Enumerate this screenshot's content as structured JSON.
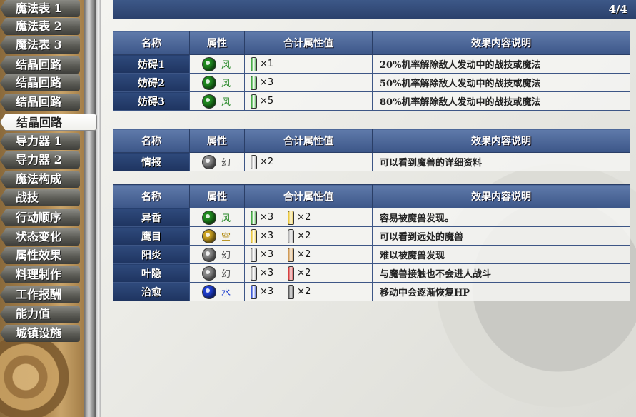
{
  "sidebar": {
    "items": [
      {
        "label": "魔法表 1",
        "active": false
      },
      {
        "label": "魔法表 2",
        "active": false
      },
      {
        "label": "魔法表 3",
        "active": false
      },
      {
        "label": "结晶回路",
        "active": false
      },
      {
        "label": "结晶回路",
        "active": false
      },
      {
        "label": "结晶回路",
        "active": false
      },
      {
        "label": "结晶回路",
        "active": true
      },
      {
        "label": "导力器 1",
        "active": false
      },
      {
        "label": "导力器 2",
        "active": false
      },
      {
        "label": "魔法构成",
        "active": false
      },
      {
        "label": "战技",
        "active": false
      },
      {
        "label": "行动顺序",
        "active": false
      },
      {
        "label": "状态变化",
        "active": false
      },
      {
        "label": "属性效果",
        "active": false
      },
      {
        "label": "料理制作",
        "active": false
      },
      {
        "label": "工作报酬",
        "active": false
      },
      {
        "label": "能力值",
        "active": false
      },
      {
        "label": "城镇设施",
        "active": false
      }
    ]
  },
  "header": {
    "page": "4/4"
  },
  "colors": {
    "wind": "#1f8a1f",
    "wind_text": "#2a8a2a",
    "illusion": "#8a8a8a",
    "illusion_text": "#555555",
    "space": "#c9a020",
    "space_text": "#b08a10",
    "water": "#1f3fd0",
    "water_text": "#1f3fd0",
    "vial_green": "#28a028",
    "vial_gray": "#a8a8a8",
    "vial_yellow": "#e8c020",
    "vial_orange": "#c88a3a",
    "vial_red": "#d02020",
    "vial_blue": "#2040d0",
    "vial_black": "#404040"
  },
  "tables": [
    {
      "headers": [
        "名称",
        "属性",
        "合计属性值",
        "效果内容说明"
      ],
      "rows": [
        {
          "name": "妨碍1",
          "attr": "风",
          "orb": "wind",
          "vals": [
            {
              "vial": "vial_green",
              "mult": "×1"
            }
          ],
          "effect": "20%机率解除敌人发动中的战技或魔法"
        },
        {
          "name": "妨碍2",
          "attr": "风",
          "orb": "wind",
          "vals": [
            {
              "vial": "vial_green",
              "mult": "×3"
            }
          ],
          "effect": "50%机率解除敌人发动中的战技或魔法"
        },
        {
          "name": "妨碍3",
          "attr": "风",
          "orb": "wind",
          "vals": [
            {
              "vial": "vial_green",
              "mult": "×5"
            }
          ],
          "effect": "80%机率解除敌人发动中的战技或魔法"
        }
      ]
    },
    {
      "headers": [
        "名称",
        "属性",
        "合计属性值",
        "效果内容说明"
      ],
      "rows": [
        {
          "name": "情报",
          "attr": "幻",
          "orb": "illusion",
          "vals": [
            {
              "vial": "vial_gray",
              "mult": "×2"
            }
          ],
          "effect": "可以看到魔兽的详细资料"
        }
      ]
    },
    {
      "headers": [
        "名称",
        "属性",
        "合计属性值",
        "效果内容说明"
      ],
      "rows": [
        {
          "name": "异香",
          "attr": "风",
          "orb": "wind",
          "vals": [
            {
              "vial": "vial_green",
              "mult": "×3"
            },
            {
              "vial": "vial_yellow",
              "mult": "×2"
            }
          ],
          "effect": "容易被魔兽发现。"
        },
        {
          "name": "鹰目",
          "attr": "空",
          "orb": "space",
          "vals": [
            {
              "vial": "vial_yellow",
              "mult": "×3"
            },
            {
              "vial": "vial_gray",
              "mult": "×2"
            }
          ],
          "effect": "可以看到远处的魔兽"
        },
        {
          "name": "阳炎",
          "attr": "幻",
          "orb": "illusion",
          "vals": [
            {
              "vial": "vial_gray",
              "mult": "×3"
            },
            {
              "vial": "vial_orange",
              "mult": "×2"
            }
          ],
          "effect": "难以被魔兽发现"
        },
        {
          "name": "叶隐",
          "attr": "幻",
          "orb": "illusion",
          "vals": [
            {
              "vial": "vial_gray",
              "mult": "×3"
            },
            {
              "vial": "vial_red",
              "mult": "×2"
            }
          ],
          "effect": "与魔兽接触也不会进人战斗"
        },
        {
          "name": "治愈",
          "attr": "水",
          "orb": "water",
          "vals": [
            {
              "vial": "vial_blue",
              "mult": "×3"
            },
            {
              "vial": "vial_black",
              "mult": "×2"
            }
          ],
          "effect": "移动中会逐渐恢复HP"
        }
      ]
    }
  ]
}
